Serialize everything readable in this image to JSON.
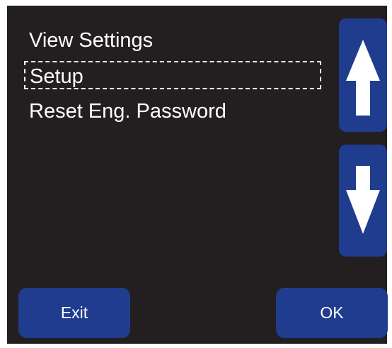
{
  "menu": {
    "items": [
      {
        "label": "View Settings",
        "selected": false
      },
      {
        "label": "Setup",
        "selected": true
      },
      {
        "label": "Reset Eng. Password",
        "selected": false
      }
    ]
  },
  "scroll": {
    "up_icon": "arrow-up-icon",
    "down_icon": "arrow-down-icon"
  },
  "buttons": {
    "exit_label": "Exit",
    "ok_label": "OK"
  },
  "colors": {
    "screen_background": "#231f20",
    "button_background": "#1f3c8e",
    "text": "#ffffff"
  }
}
